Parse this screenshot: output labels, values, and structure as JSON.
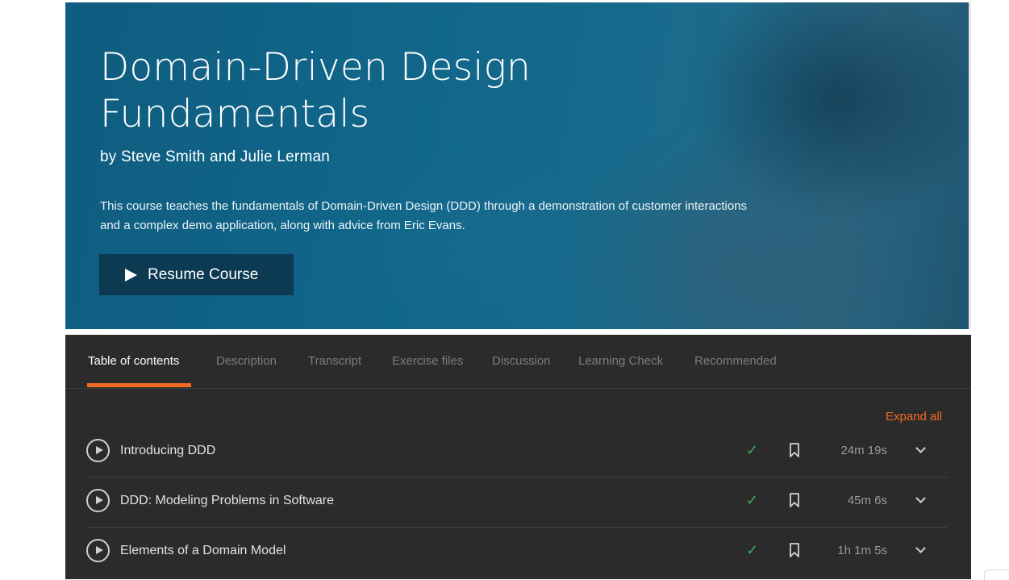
{
  "course": {
    "title": "Domain-Driven Design Fundamentals",
    "authors": "by Steve Smith and Julie Lerman",
    "description": "This course teaches the fundamentals of Domain-Driven Design (DDD) through a demonstration of customer interactions and a complex demo application, along with advice from Eric Evans.",
    "resume_label": "Resume Course"
  },
  "tabs": [
    {
      "label": "Table of contents",
      "active": true
    },
    {
      "label": "Description"
    },
    {
      "label": "Transcript"
    },
    {
      "label": "Exercise files"
    },
    {
      "label": "Discussion"
    },
    {
      "label": "Learning Check"
    },
    {
      "label": "Recommended"
    }
  ],
  "toc": {
    "expand_label": "Expand all",
    "modules": [
      {
        "title": "Introducing DDD",
        "completed": true,
        "duration": "24m 19s"
      },
      {
        "title": "DDD: Modeling Problems in Software",
        "completed": true,
        "duration": "45m 6s"
      },
      {
        "title": "Elements of a Domain Model",
        "completed": true,
        "duration": "1h 1m 5s"
      }
    ]
  },
  "icons": {
    "play": "play-icon",
    "check": "check-icon",
    "bookmark": "bookmark-icon",
    "chevron": "chevron-down-icon"
  },
  "colors": {
    "accent": "#f26a21",
    "hero": "#0f5d80",
    "panel": "#2b2b2b",
    "check": "#3fa75a"
  }
}
